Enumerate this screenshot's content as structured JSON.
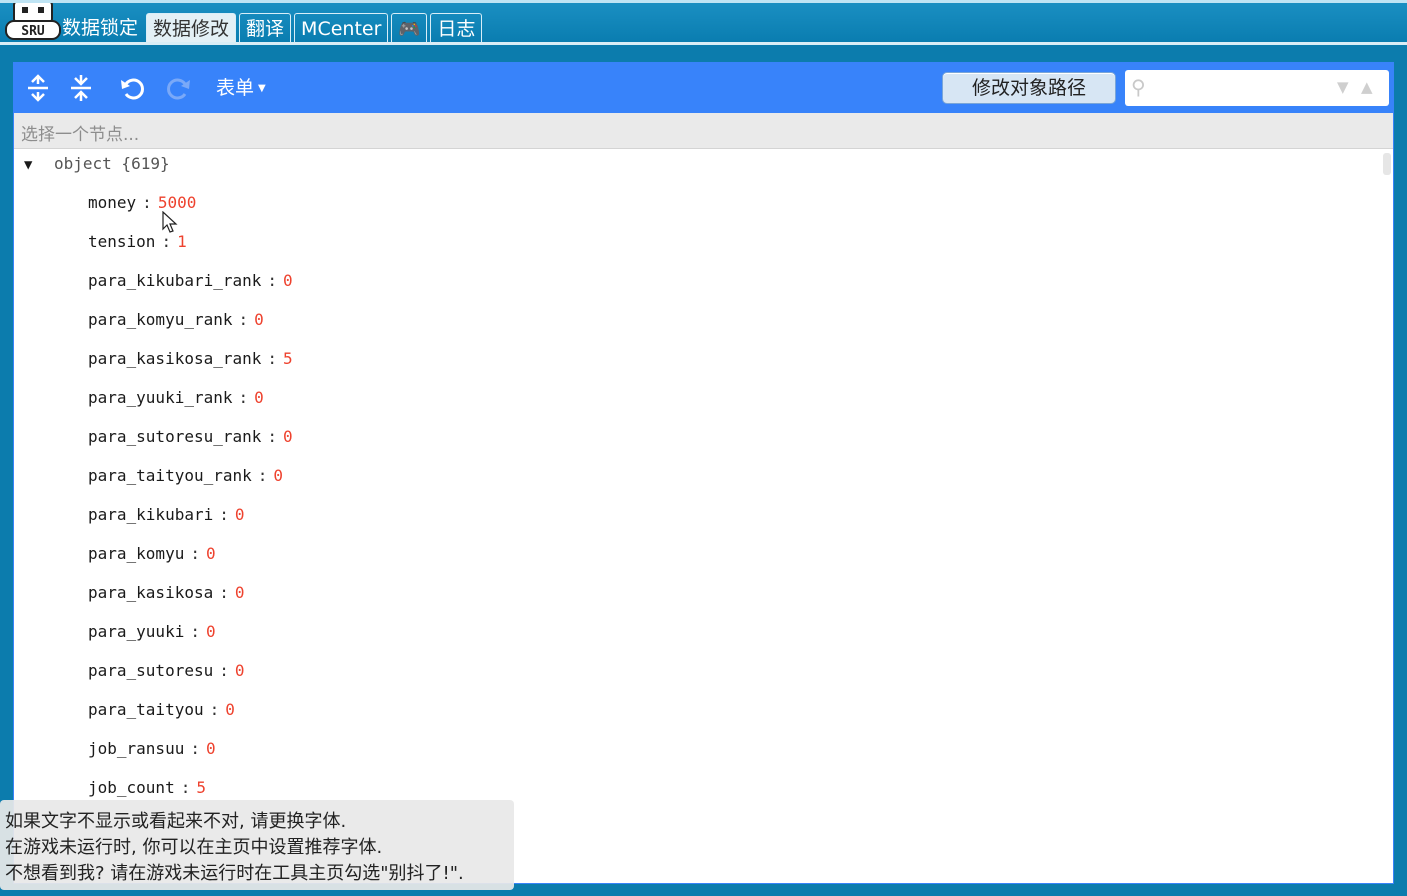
{
  "tabs": [
    {
      "label": "数据锁定",
      "active": false
    },
    {
      "label": "数据修改",
      "active": true
    },
    {
      "label": "翻译",
      "active": false
    },
    {
      "label": "MCenter",
      "active": false
    },
    {
      "label": "🎮",
      "active": false
    },
    {
      "label": "日志",
      "active": false
    }
  ],
  "logo_text": "SRU",
  "menu": {
    "expand_all_icon": "expand-all-icon",
    "collapse_all_icon": "collapse-all-icon",
    "undo_icon": "undo-icon",
    "redo_icon": "redo-icon",
    "mode_label": "表单",
    "path_button_label": "修改对象路径",
    "search_placeholder": ""
  },
  "navbar_placeholder": "选择一个节点...",
  "tree": {
    "root_label": "object {619}",
    "fields": [
      {
        "key": "money",
        "value": "5000"
      },
      {
        "key": "tension",
        "value": "1"
      },
      {
        "key": "para_kikubari_rank",
        "value": "0"
      },
      {
        "key": "para_komyu_rank",
        "value": "0"
      },
      {
        "key": "para_kasikosa_rank",
        "value": "5"
      },
      {
        "key": "para_yuuki_rank",
        "value": "0"
      },
      {
        "key": "para_sutoresu_rank",
        "value": "0"
      },
      {
        "key": "para_taityou_rank",
        "value": "0"
      },
      {
        "key": "para_kikubari",
        "value": "0"
      },
      {
        "key": "para_komyu",
        "value": "0"
      },
      {
        "key": "para_kasikosa",
        "value": "0"
      },
      {
        "key": "para_yuuki",
        "value": "0"
      },
      {
        "key": "para_sutoresu",
        "value": "0"
      },
      {
        "key": "para_taityou",
        "value": "0"
      },
      {
        "key": "job_ransuu",
        "value": "0"
      },
      {
        "key": "job_count",
        "value": "5"
      }
    ]
  },
  "notice": {
    "line1": "如果文字不显示或看起来不对, 请更换字体.",
    "line2": "在游戏未运行时, 你可以在主页中设置推荐字体.",
    "line3": "不想看到我? 请在游戏未运行时在工具主页勾选\"别抖了!\"."
  },
  "colors": {
    "menu_bg": "#3883fa",
    "frame_bg": "#0c7cad",
    "value": "#ee422e"
  }
}
